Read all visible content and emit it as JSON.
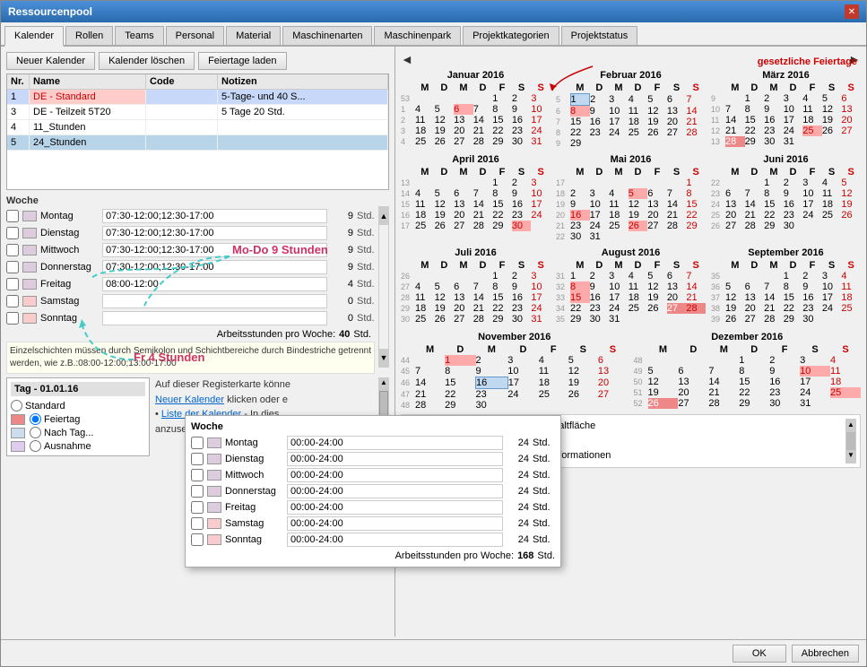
{
  "window": {
    "title": "Ressourcenpool"
  },
  "tabs": [
    {
      "label": "Kalender",
      "active": true
    },
    {
      "label": "Rollen"
    },
    {
      "label": "Teams"
    },
    {
      "label": "Personal"
    },
    {
      "label": "Material"
    },
    {
      "label": "Maschinenarten"
    },
    {
      "label": "Maschinenpark"
    },
    {
      "label": "Projektkategorien"
    },
    {
      "label": "Projektstatus"
    }
  ],
  "buttons": {
    "neuer_kalender": "Neuer Kalender",
    "kalender_loeschen": "Kalender löschen",
    "feiertage_laden": "Feiertage laden",
    "ok": "OK",
    "abbrechen": "Abbrechen"
  },
  "calendar_list": {
    "headers": [
      "Nr.",
      "Name",
      "Code",
      "Notizen"
    ],
    "rows": [
      {
        "nr": "1",
        "name": "DE - Standard",
        "code": "",
        "notizen": "5-Tage- und 40 S...",
        "selected": true
      },
      {
        "nr": "3",
        "name": "DE - Teilzeit 5T20",
        "code": "",
        "notizen": "5 Tage 20 Std."
      },
      {
        "nr": "4",
        "name": "11_Stunden",
        "code": "",
        "notizen": ""
      },
      {
        "nr": "5",
        "name": "24_Stunden",
        "code": "",
        "notizen": "",
        "selected2": true
      }
    ]
  },
  "woche": {
    "title": "Woche",
    "rows": [
      {
        "day": "Montag",
        "time": "07:30-12:00;12:30-17:00",
        "hours": "9",
        "std": "Std."
      },
      {
        "day": "Dienstag",
        "time": "07:30-12:00;12:30-17:00",
        "hours": "9",
        "std": "Std."
      },
      {
        "day": "Mittwoch",
        "time": "07:30-12:00;12:30-17:00",
        "hours": "9",
        "std": "Std."
      },
      {
        "day": "Donnerstag",
        "time": "07:30-12:00;12:30-17:00",
        "hours": "9",
        "std": "Std."
      },
      {
        "day": "Freitag",
        "time": "08:00-12:00",
        "hours": "4",
        "std": "Std."
      },
      {
        "day": "Samstag",
        "time": "",
        "hours": "0",
        "std": "Std."
      },
      {
        "day": "Sonntag",
        "time": "",
        "hours": "0",
        "std": "Std."
      }
    ],
    "arbeitsstunden_label": "Arbeitsstunden pro Woche:",
    "arbeitsstunden_value": "40",
    "arbeitsstunden_std": "Std."
  },
  "hint": "Einzelschichten müssen durch Semikolon und Schichtbereiche durch Bindestriche getrennt werden, wie z.B.:08:00-12:00;13:00-17:00",
  "tag_section": {
    "title": "Tag - 01.01.16",
    "options": [
      {
        "label": "Standard"
      },
      {
        "label": "Feiertag",
        "selected": true
      },
      {
        "label": "Nach Tag..."
      },
      {
        "label": "Ausnahme"
      }
    ]
  },
  "info_text": {
    "line1": "Auf dieser Registerkarte könne",
    "line2": "Neuer Kalender klicken oder e",
    "bullet1": "Liste der Kalender - In dies",
    "bullet1_rest": "anzusehen oder zu ändern",
    "bullet2_rest": "einen der Kalender, um die Detailinformationen"
  },
  "annotations": {
    "mo_do": "Mo-Do 9 Stunden",
    "fr": "Fr 4 Stunden",
    "gesetzliche": "gesetzliche Feiertage"
  },
  "months": [
    {
      "name": "Januar 2016",
      "headers": [
        "M",
        "D",
        "M",
        "D",
        "F",
        "S",
        "S"
      ],
      "weeks": [
        {
          "wn": "53",
          "days": [
            "",
            "",
            "",
            "",
            "1",
            "2",
            "3"
          ]
        },
        {
          "wn": "1",
          "days": [
            "4",
            "5",
            "6",
            "7",
            "8",
            "9",
            "10"
          ]
        },
        {
          "wn": "2",
          "days": [
            "11",
            "12",
            "13",
            "14",
            "15",
            "16",
            "17"
          ]
        },
        {
          "wn": "3",
          "days": [
            "18",
            "19",
            "20",
            "21",
            "22",
            "23",
            "24"
          ]
        },
        {
          "wn": "4",
          "days": [
            "25",
            "26",
            "27",
            "28",
            "29",
            "30",
            "31"
          ]
        }
      ],
      "holidays": [
        "1"
      ],
      "selected": []
    },
    {
      "name": "Februar 2016",
      "headers": [
        "M",
        "D",
        "M",
        "D",
        "F",
        "S",
        "S"
      ],
      "weeks": [
        {
          "wn": "5",
          "days": [
            "1",
            "2",
            "3",
            "4",
            "5",
            "6",
            "7"
          ]
        },
        {
          "wn": "6",
          "days": [
            "8",
            "9",
            "10",
            "11",
            "12",
            "13",
            "14"
          ]
        },
        {
          "wn": "7",
          "days": [
            "15",
            "16",
            "17",
            "18",
            "19",
            "20",
            "21"
          ]
        },
        {
          "wn": "8",
          "days": [
            "22",
            "23",
            "24",
            "25",
            "26",
            "27",
            "28"
          ]
        },
        {
          "wn": "9",
          "days": [
            "29",
            ""
          ]
        }
      ],
      "holidays": [],
      "selected": [
        "8"
      ]
    },
    {
      "name": "März 2016",
      "headers": [
        "M",
        "D",
        "M",
        "D",
        "F",
        "S",
        "S"
      ],
      "weeks": [
        {
          "wn": "9",
          "days": [
            "",
            "1",
            "2",
            "3",
            "4",
            "5",
            "6"
          ]
        },
        {
          "wn": "10",
          "days": [
            "7",
            "8",
            "9",
            "10",
            "11",
            "12",
            "13"
          ]
        },
        {
          "wn": "11",
          "days": [
            "14",
            "15",
            "16",
            "17",
            "18",
            "19",
            "20"
          ]
        },
        {
          "wn": "12",
          "days": [
            "21",
            "22",
            "23",
            "24",
            "25",
            "26",
            "27"
          ]
        },
        {
          "wn": "13",
          "days": [
            "28",
            "29",
            "30",
            "31",
            ""
          ]
        }
      ],
      "holidays": [
        "25"
      ],
      "selected": [
        "28"
      ]
    },
    {
      "name": "April 2016",
      "headers": [
        "M",
        "D",
        "M",
        "D",
        "F",
        "S",
        "S"
      ],
      "weeks": [
        {
          "wn": "13",
          "days": [
            "",
            "",
            "",
            "",
            "1",
            "2",
            "3"
          ]
        },
        {
          "wn": "14",
          "days": [
            "4",
            "5",
            "6",
            "7",
            "8",
            "9",
            "10"
          ]
        },
        {
          "wn": "15",
          "days": [
            "11",
            "12",
            "13",
            "14",
            "15",
            "16",
            "17"
          ]
        },
        {
          "wn": "16",
          "days": [
            "18",
            "19",
            "20",
            "21",
            "22",
            "23",
            "24"
          ]
        },
        {
          "wn": "17",
          "days": [
            "25",
            "26",
            "27",
            "28",
            "29",
            "30",
            ""
          ]
        }
      ],
      "holidays": [],
      "selected": []
    },
    {
      "name": "Mai 2016",
      "headers": [
        "M",
        "D",
        "M",
        "D",
        "F",
        "S",
        "S"
      ],
      "weeks": [
        {
          "wn": "17",
          "days": [
            "",
            "",
            "",
            "",
            "",
            "",
            "1"
          ]
        },
        {
          "wn": "18",
          "days": [
            "2",
            "3",
            "4",
            "5",
            "6",
            "7",
            "8"
          ]
        },
        {
          "wn": "19",
          "days": [
            "9",
            "10",
            "11",
            "12",
            "13",
            "14",
            "15"
          ]
        },
        {
          "wn": "20",
          "days": [
            "16",
            "17",
            "18",
            "19",
            "20",
            "21",
            "22"
          ]
        },
        {
          "wn": "21",
          "days": [
            "23",
            "24",
            "25",
            "26",
            "27",
            "28",
            "29"
          ]
        },
        {
          "wn": "22",
          "days": [
            "30",
            "31"
          ]
        }
      ],
      "holidays": [
        "5",
        "16",
        "26"
      ],
      "selected": []
    },
    {
      "name": "Juni 2016",
      "headers": [
        "M",
        "D",
        "M",
        "D",
        "F",
        "S",
        "S"
      ],
      "weeks": [
        {
          "wn": "22",
          "days": [
            "",
            "",
            "1",
            "2",
            "3",
            "4",
            "5"
          ]
        },
        {
          "wn": "23",
          "days": [
            "6",
            "7",
            "8",
            "9",
            "10",
            "11",
            "12"
          ]
        },
        {
          "wn": "24",
          "days": [
            "13",
            "14",
            "15",
            "16",
            "17",
            "18",
            "19"
          ]
        },
        {
          "wn": "25",
          "days": [
            "20",
            "21",
            "22",
            "23",
            "24",
            "25",
            "26"
          ]
        },
        {
          "wn": "26",
          "days": [
            "27",
            "28",
            "29",
            "30",
            ""
          ]
        }
      ],
      "holidays": [],
      "selected": []
    },
    {
      "name": "Juli 2016",
      "headers": [
        "M",
        "D",
        "M",
        "D",
        "F",
        "S",
        "S"
      ],
      "weeks": [
        {
          "wn": "26",
          "days": [
            "",
            "",
            "",
            "",
            "1",
            "2",
            "3"
          ]
        },
        {
          "wn": "27",
          "days": [
            "4",
            "5",
            "6",
            "7",
            "8",
            "9",
            "10"
          ]
        },
        {
          "wn": "28",
          "days": [
            "11",
            "12",
            "13",
            "14",
            "15",
            "16",
            "17"
          ]
        },
        {
          "wn": "29",
          "days": [
            "18",
            "19",
            "20",
            "21",
            "22",
            "23",
            "24"
          ]
        },
        {
          "wn": "30",
          "days": [
            "25",
            "26",
            "27",
            "28",
            "29",
            "30",
            "31"
          ]
        }
      ],
      "holidays": [],
      "selected": []
    },
    {
      "name": "August 2016",
      "headers": [
        "M",
        "D",
        "M",
        "D",
        "F",
        "S",
        "S"
      ],
      "weeks": [
        {
          "wn": "31",
          "days": [
            "1",
            "2",
            "3",
            "4",
            "5",
            "6",
            "7"
          ]
        },
        {
          "wn": "32",
          "days": [
            "8",
            "9",
            "10",
            "11",
            "12",
            "13",
            "14"
          ]
        },
        {
          "wn": "33",
          "days": [
            "15",
            "16",
            "17",
            "18",
            "19",
            "20",
            "21"
          ]
        },
        {
          "wn": "34",
          "days": [
            "22",
            "23",
            "24",
            "25",
            "26",
            "27",
            "28"
          ]
        },
        {
          "wn": "35",
          "days": [
            "29",
            "30",
            "31",
            ""
          ]
        }
      ],
      "holidays": [
        "8",
        "15"
      ],
      "selected": [
        "27",
        "28"
      ]
    },
    {
      "name": "September 2016",
      "headers": [
        "M",
        "D",
        "M",
        "D",
        "F",
        "S",
        "S"
      ],
      "weeks": [
        {
          "wn": "35",
          "days": [
            "",
            "",
            "",
            "1",
            "2",
            "3",
            "4"
          ]
        },
        {
          "wn": "36",
          "days": [
            "5",
            "6",
            "7",
            "8",
            "9",
            "10",
            "11"
          ]
        },
        {
          "wn": "37",
          "days": [
            "12",
            "13",
            "14",
            "15",
            "16",
            "17",
            "18"
          ]
        },
        {
          "wn": "38",
          "days": [
            "19",
            "20",
            "21",
            "22",
            "23",
            "24",
            "25"
          ]
        },
        {
          "wn": "39",
          "days": [
            "26",
            "27",
            "28",
            "29",
            "30",
            ""
          ]
        }
      ],
      "holidays": [],
      "selected": []
    },
    {
      "name": "November 2016",
      "headers": [
        "M",
        "D",
        "M",
        "D",
        "F",
        "S",
        "S"
      ],
      "weeks": [
        {
          "wn": "44",
          "days": [
            "",
            "1",
            "2",
            "3",
            "4",
            "5",
            "6"
          ]
        },
        {
          "wn": "45",
          "days": [
            "7",
            "8",
            "9",
            "10",
            "11",
            "12",
            "13"
          ]
        },
        {
          "wn": "46",
          "days": [
            "14",
            "15",
            "16",
            "17",
            "18",
            "19",
            "20"
          ]
        },
        {
          "wn": "47",
          "days": [
            "21",
            "22",
            "23",
            "24",
            "25",
            "26",
            "27"
          ]
        },
        {
          "wn": "48",
          "days": [
            "28",
            "29",
            "30",
            ""
          ]
        }
      ],
      "holidays": [
        "1"
      ],
      "selected": []
    },
    {
      "name": "Dezember 2016",
      "headers": [
        "M",
        "D",
        "M",
        "D",
        "F",
        "S",
        "S"
      ],
      "weeks": [
        {
          "wn": "48",
          "days": [
            "",
            "",
            "",
            "1",
            "2",
            "3",
            "4"
          ]
        },
        {
          "wn": "49",
          "days": [
            "5",
            "6",
            "7",
            "8",
            "9",
            "10",
            "11"
          ]
        },
        {
          "wn": "50",
          "days": [
            "12",
            "13",
            "14",
            "15",
            "16",
            "17",
            "18"
          ]
        },
        {
          "wn": "51",
          "days": [
            "19",
            "20",
            "21",
            "22",
            "23",
            "24",
            "25"
          ]
        },
        {
          "wn": "52",
          "days": [
            "26",
            "27",
            "28",
            "29",
            "30",
            "31",
            ""
          ]
        }
      ],
      "holidays": [
        "25",
        "26"
      ],
      "selected": [
        "26"
      ]
    }
  ],
  "overlay": {
    "woche_title": "Woche",
    "rows": [
      {
        "day": "Montag",
        "time": "00:00-24:00",
        "hours": "24",
        "std": "Std."
      },
      {
        "day": "Dienstag",
        "time": "00:00-24:00",
        "hours": "24",
        "std": "Std."
      },
      {
        "day": "Mittwoch",
        "time": "00:00-24:00",
        "hours": "24",
        "std": "Std."
      },
      {
        "day": "Donnerstag",
        "time": "00:00-24:00",
        "hours": "24",
        "std": "Std."
      },
      {
        "day": "Freitag",
        "time": "00:00-24:00",
        "hours": "24",
        "std": "Std."
      },
      {
        "day": "Samstag",
        "time": "00:00-24:00",
        "hours": "24",
        "std": "Std."
      },
      {
        "day": "Sonntag",
        "time": "00:00-24:00",
        "hours": "24",
        "std": "Std."
      }
    ],
    "arbeitsstunden_label": "Arbeitsstunden pro Woche:",
    "arbeitsstunden_value": "168",
    "arbeitsstunden_std": "Std."
  }
}
